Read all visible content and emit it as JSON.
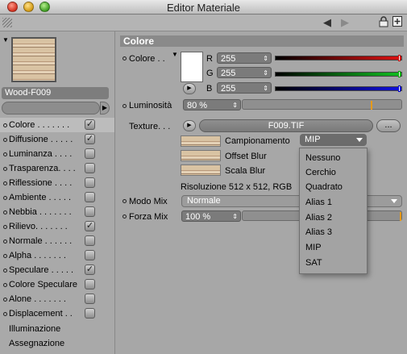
{
  "window": {
    "title": "Editor Materiale"
  },
  "toolbar": {
    "icons": [
      "grip-icon",
      "arrow-left-icon",
      "arrow-right-icon",
      "lock-icon",
      "new-window-icon"
    ]
  },
  "material": {
    "name": "Wood-F009",
    "channels": [
      {
        "label": "Colore . . . . . . .",
        "checked": true,
        "selected": true
      },
      {
        "label": "Diffusione . . . . .",
        "checked": true
      },
      {
        "label": "Luminanza . . . .",
        "checked": false
      },
      {
        "label": "Trasparenza. . . .",
        "checked": false
      },
      {
        "label": "Riflessione . . . .",
        "checked": false
      },
      {
        "label": "Ambiente . . . . .",
        "checked": false
      },
      {
        "label": "Nebbia . . . . . . .",
        "checked": false
      },
      {
        "label": "Rilievo. . . . . . .",
        "checked": true
      },
      {
        "label": "Normale . . . . . .",
        "checked": false
      },
      {
        "label": "Alpha . . . . . . .",
        "checked": false
      },
      {
        "label": "Speculare . . . . .",
        "checked": true
      },
      {
        "label": "Colore Speculare",
        "checked": false
      },
      {
        "label": "Alone . . . . . . .",
        "checked": false
      },
      {
        "label": "Displacement . .",
        "checked": false
      }
    ],
    "extra_items": [
      "Illuminazione",
      "Assegnazione"
    ]
  },
  "colore": {
    "section_title": "Colore",
    "color_label": "Colore . .",
    "r_label": "R",
    "r_value": "255",
    "g_label": "G",
    "g_value": "255",
    "b_label": "B",
    "b_value": "255",
    "luminosita_label": "Luminosità",
    "luminosita_value": "80 %",
    "texture_label": "Texture. . .",
    "texture_file": "F009.TIF",
    "more_button": "...",
    "campionamento_label": "Campionamento",
    "campionamento_value": "MIP",
    "offset_blur_label": "Offset Blur",
    "scala_blur_label": "Scala Blur",
    "risoluzione_text": "Risoluzione 512 x 512, RGB",
    "modo_mix_label": "Modo Mix",
    "modo_mix_value": "Normale",
    "forza_mix_label": "Forza Mix",
    "forza_mix_value": "100 %"
  },
  "dropdown": {
    "options": [
      "Nessuno",
      "Cerchio",
      "Quadrato",
      "Alias 1",
      "Alias 2",
      "Alias 3",
      "MIP",
      "SAT"
    ]
  },
  "colors": {
    "red": "#e01010",
    "green": "#10c020",
    "blue": "#1010e0",
    "accent": "#e59a1a"
  }
}
